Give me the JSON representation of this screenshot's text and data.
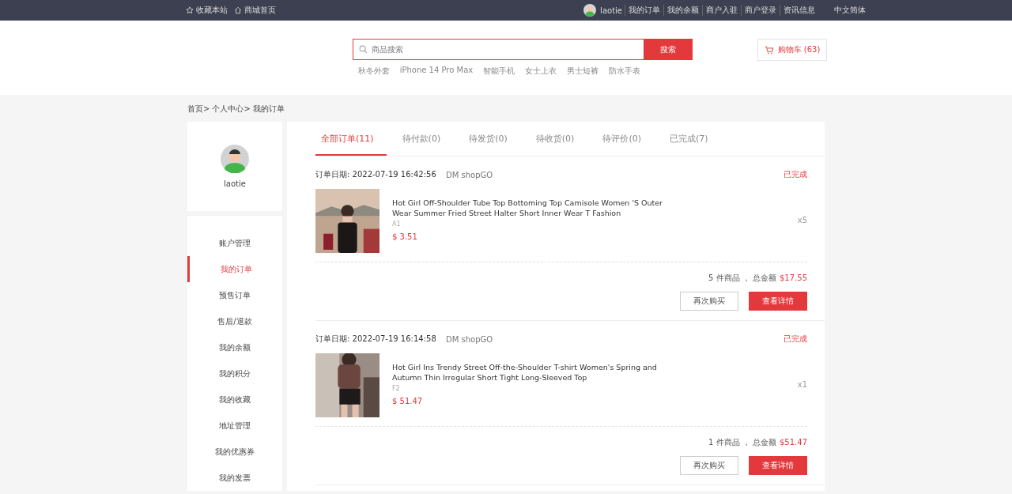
{
  "topbar": {
    "left_links": [
      {
        "kind": "star",
        "label": "收藏本站"
      },
      {
        "kind": "home",
        "label": "商城首页"
      }
    ],
    "user": "laotie",
    "links": [
      "我的订单",
      "我的余额",
      "商户入驻",
      "商户登录",
      "资讯信息"
    ],
    "language": "中文简体"
  },
  "search": {
    "placeholder": "商品搜索",
    "button": "搜索",
    "hot": [
      "秋冬外套",
      "iPhone 14 Pro Max",
      "智能手机",
      "女士上衣",
      "男士短裤",
      "防水手表"
    ]
  },
  "cart": {
    "label": "购物车 (63)"
  },
  "breadcrumb": [
    "首页>",
    "个人中心>",
    "我的订单"
  ],
  "profile": {
    "name": "laotie"
  },
  "menu": [
    {
      "label": "账户管理",
      "selected": false
    },
    {
      "label": "我的订单",
      "selected": true
    },
    {
      "label": "预售订单",
      "selected": false
    },
    {
      "label": "售后/退款",
      "selected": false
    },
    {
      "label": "我的余额",
      "selected": false
    },
    {
      "label": "我的积分",
      "selected": false
    },
    {
      "label": "我的收藏",
      "selected": false
    },
    {
      "label": "地址管理",
      "selected": false
    },
    {
      "label": "我的优惠券",
      "selected": false
    },
    {
      "label": "我的发票",
      "selected": false
    }
  ],
  "tabs": [
    {
      "label": "全部订单(11)",
      "selected": true
    },
    {
      "label": "待付款(0)",
      "selected": false
    },
    {
      "label": "待发货(0)",
      "selected": false
    },
    {
      "label": "待收货(0)",
      "selected": false
    },
    {
      "label": "待评价(0)",
      "selected": false
    },
    {
      "label": "已完成(7)",
      "selected": false
    }
  ],
  "orders": [
    {
      "date": "订单日期: 2022-07-19 16:42:56",
      "shop": "DM shopGO",
      "status": "已完成",
      "title": "Hot Girl Off-Shoulder Tube Top Bottoming Top Camisole Women 'S Outer Wear Summer Fried Street Halter Short Inner Wear T Fashion",
      "sku": "A1",
      "price": "$ 3.51",
      "qty": "x5",
      "summary": "5 件商品 ， 总金额",
      "total": "$17.55",
      "buttons": [
        "再次购买",
        "查看详情"
      ]
    },
    {
      "date": "订单日期: 2022-07-19 16:14:58",
      "shop": "DM shopGO",
      "status": "已完成",
      "title": "Hot Girl Ins Trendy Street Off-the-Shoulder T-shirt Women's Spring and Autumn Thin Irregular Short Tight Long-Sleeved Top",
      "sku": "F2",
      "price": "$ 51.47",
      "qty": "x1",
      "summary": "1 件商品 ， 总金额",
      "total": "$51.47",
      "buttons": [
        "再次购买",
        "查看详情"
      ]
    }
  ]
}
